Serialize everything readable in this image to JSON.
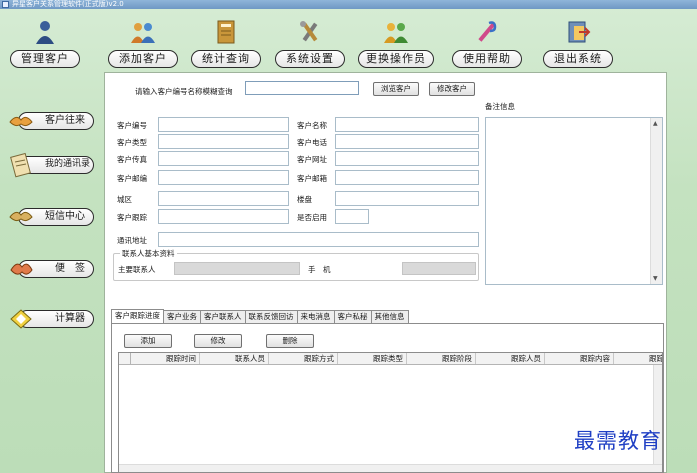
{
  "window": {
    "title": "异星客户关系管理软件(正式版)v2.0"
  },
  "toolbar": {
    "items": [
      {
        "label": "管理客户",
        "icon": "user-icon"
      },
      {
        "label": "添加客户",
        "icon": "add-users-icon"
      },
      {
        "label": "统计查询",
        "icon": "statistics-book-icon"
      },
      {
        "label": "系统设置",
        "icon": "tools-icon"
      },
      {
        "label": "更换操作员",
        "icon": "switch-operator-icon"
      },
      {
        "label": "使用帮助",
        "icon": "help-icon"
      },
      {
        "label": "退出系统",
        "icon": "exit-icon"
      }
    ]
  },
  "sidebar": {
    "items": [
      {
        "label": "客户往来",
        "icon": "handshake-icon"
      },
      {
        "label": "我的通讯录",
        "icon": "address-book-icon"
      },
      {
        "label": "短信中心",
        "icon": "sms-icon"
      },
      {
        "label": "便　签",
        "icon": "note-icon"
      },
      {
        "label": "计算器",
        "icon": "calculator-icon"
      }
    ]
  },
  "search": {
    "label": "请输入客户编号名称模糊查询",
    "value": "",
    "browse_button": "浏览客户",
    "modify_button": "修改客户"
  },
  "form": {
    "customer_no": "客户编号",
    "customer_name": "客户名称",
    "customer_type": "客户类型",
    "customer_phone": "客户电话",
    "customer_fax": "客户传真",
    "customer_website": "客户网址",
    "customer_postcode": "客户邮编",
    "customer_email": "客户邮箱",
    "region": "城区",
    "zone": "楼盘",
    "customer_follow": "客户跟踪",
    "enabled": "是否启用",
    "address": "通讯地址",
    "remark": "备注信息"
  },
  "contact": {
    "legend": "联系人基本资料",
    "main_contact": "主要联系人",
    "mobile": "手　机"
  },
  "tabs": {
    "items": [
      "客户跟踪进度",
      "客户业务",
      "客户联系人",
      "联系反馈回访",
      "来电消息",
      "客户私秘",
      "其他信息"
    ]
  },
  "tracking": {
    "add_button": "添加",
    "modify_button": "修改",
    "delete_button": "删除",
    "columns": [
      "跟踪时间",
      "联系人员",
      "跟踪方式",
      "跟踪类型",
      "跟踪阶段",
      "跟踪人员",
      "跟踪内容",
      "跟踪结果"
    ]
  },
  "watermark": "最需教育"
}
